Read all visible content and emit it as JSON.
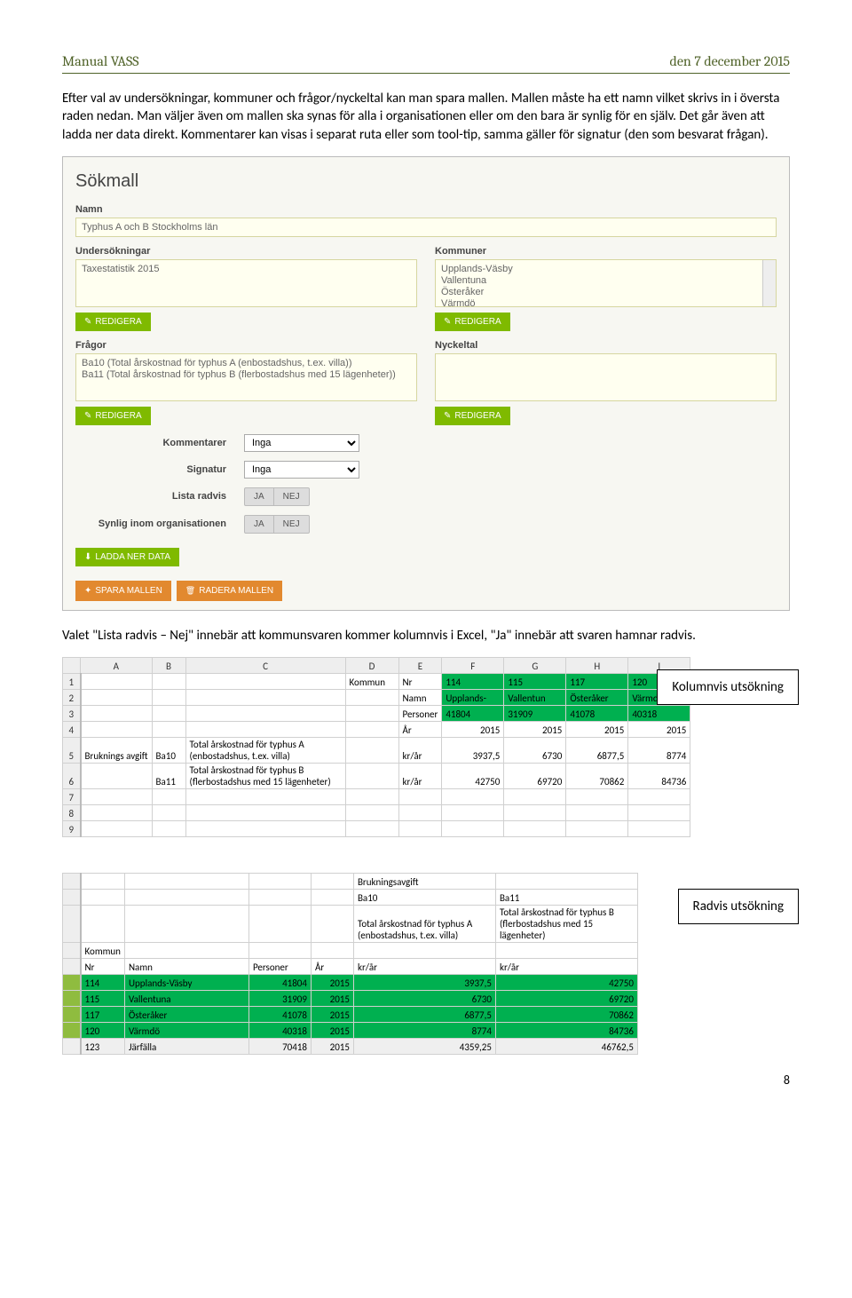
{
  "header": {
    "left": "Manual VASS",
    "right": "den 7 december 2015"
  },
  "para1": "Efter val av undersökningar, kommuner och frågor/nyckeltal kan man spara mallen. Mallen måste ha ett namn vilket skrivs in i översta raden nedan. Man väljer även om mallen ska synas för alla i organisationen eller om den bara är synlig för en själv. Det går även att ladda ner data direkt. Kommentarer kan visas i separat ruta eller som tool-tip, samma gäller för signatur (den som besvarat frågan).",
  "form": {
    "title": "Sökmall",
    "name_label": "Namn",
    "name_value": "Typhus A och B Stockholms län",
    "under_label": "Undersökningar",
    "under_value": "Taxestatistik 2015",
    "kommuner_label": "Kommuner",
    "kommuner_values": "Upplands-Väsby\nVallentuna\nÖsteråker\nVärmdö",
    "fragor_label": "Frågor",
    "fragor_values": "Ba10 (Total årskostnad för typhus A (enbostadshus, t.ex. villa))\nBa11 (Total årskostnad för typhus B (flerbostadshus med 15 lägenheter))",
    "nyckeltal_label": "Nyckeltal",
    "redigera": "REDIGERA",
    "kommentarer_label": "Kommentarer",
    "signatur_label": "Signatur",
    "lista_label": "Lista radvis",
    "synlig_label": "Synlig inom organisationen",
    "inga": "Inga",
    "ja": "JA",
    "nej": "NEJ",
    "ladda_ner": "LADDA NER DATA",
    "spara": "SPARA MALLEN",
    "radera": "RADERA MALLEN"
  },
  "para2": "Valet \"Lista radvis – Nej\" innebär att kommunsvaren kommer kolumnvis i Excel, \"Ja\" innebär att svaren hamnar radvis.",
  "callout1": "Kolumnvis utsökning",
  "callout2": "Radvis utsökning",
  "page_number": "8",
  "excel1": {
    "cols": [
      "A",
      "B",
      "C",
      "D",
      "E",
      "F",
      "G",
      "H",
      "I"
    ],
    "rows": [
      [
        "1",
        "",
        "",
        "",
        "Kommun",
        "Nr",
        "114",
        "115",
        "117",
        "120"
      ],
      [
        "2",
        "",
        "",
        "",
        "",
        "Namn",
        "Upplands-",
        "Vallentun",
        "Österåker",
        "Värmdö"
      ],
      [
        "3",
        "",
        "",
        "",
        "",
        "Personer",
        "41804",
        "31909",
        "41078",
        "40318"
      ],
      [
        "4",
        "",
        "",
        "",
        "",
        "År",
        "2015",
        "2015",
        "2015",
        "2015"
      ],
      [
        "5",
        "Bruknings avgift",
        "Ba10",
        "Total årskostnad för typhus A (enbostadshus, t.ex. villa)",
        "",
        "kr/år",
        "3937,5",
        "6730",
        "6877,5",
        "8774"
      ],
      [
        "6",
        "",
        "Ba11",
        "Total årskostnad för typhus B (flerbostadshus med 15 lägenheter)",
        "",
        "kr/år",
        "42750",
        "69720",
        "70862",
        "84736"
      ],
      [
        "7",
        "",
        "",
        "",
        "",
        "",
        "",
        "",
        "",
        ""
      ],
      [
        "8",
        "",
        "",
        "",
        "",
        "",
        "",
        "",
        "",
        ""
      ],
      [
        "9",
        "",
        "",
        "",
        "",
        "",
        "",
        "",
        "",
        ""
      ]
    ]
  },
  "excel2": {
    "header_top": [
      "",
      "",
      "",
      "",
      "Brukningsavgift",
      ""
    ],
    "header_mid": [
      "",
      "",
      "",
      "",
      "Ba10",
      "Ba11"
    ],
    "header_desc": [
      "",
      "",
      "",
      "",
      "Total årskostnad för typhus A (enbostadshus, t.ex. villa)",
      "Total årskostnad för typhus B (flerbostadshus med 15 lägenheter)"
    ],
    "header_lbl": [
      "Kommun",
      "",
      "",
      "",
      "",
      ""
    ],
    "header_cols": [
      "Nr",
      "Namn",
      "Personer",
      "År",
      "kr/år",
      "kr/år"
    ],
    "rows": [
      [
        "114",
        "Upplands-Väsby",
        "41804",
        "2015",
        "3937,5",
        "42750"
      ],
      [
        "115",
        "Vallentuna",
        "31909",
        "2015",
        "6730",
        "69720"
      ],
      [
        "117",
        "Österåker",
        "41078",
        "2015",
        "6877,5",
        "70862"
      ],
      [
        "120",
        "Värmdö",
        "40318",
        "2015",
        "8774",
        "84736"
      ],
      [
        "123",
        "Järfälla",
        "70418",
        "2015",
        "4359,25",
        "46762,5"
      ]
    ]
  }
}
